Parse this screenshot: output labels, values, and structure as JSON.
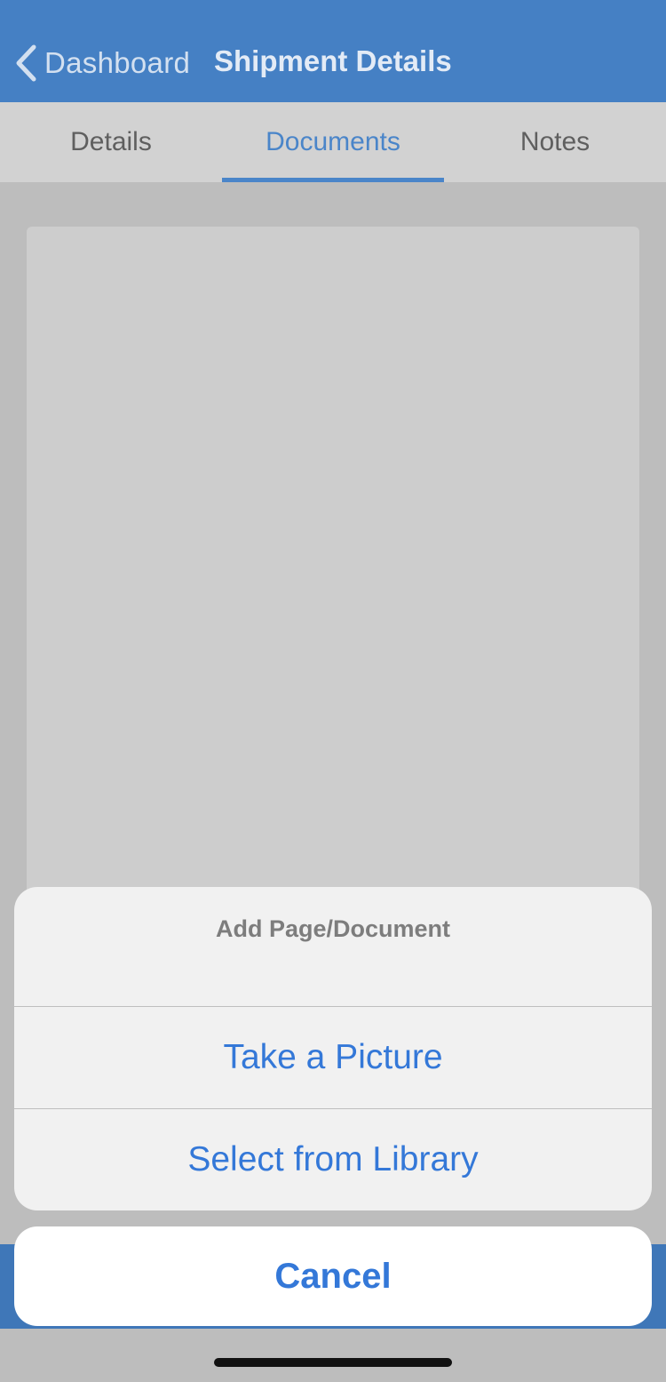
{
  "nav": {
    "back_label": "Dashboard",
    "title": "Shipment Details",
    "back_icon": "chevron-left-icon"
  },
  "tabs": [
    {
      "label": "Details",
      "active": false
    },
    {
      "label": "Documents",
      "active": true
    },
    {
      "label": "Notes",
      "active": false
    }
  ],
  "action_sheet": {
    "title": "Add Page/Document",
    "options": [
      "Take a Picture",
      "Select from Library"
    ],
    "cancel_label": "Cancel"
  },
  "colors": {
    "navbar": "#4580c4",
    "accent": "#3478d8",
    "active_tab": "#4a85c9"
  }
}
